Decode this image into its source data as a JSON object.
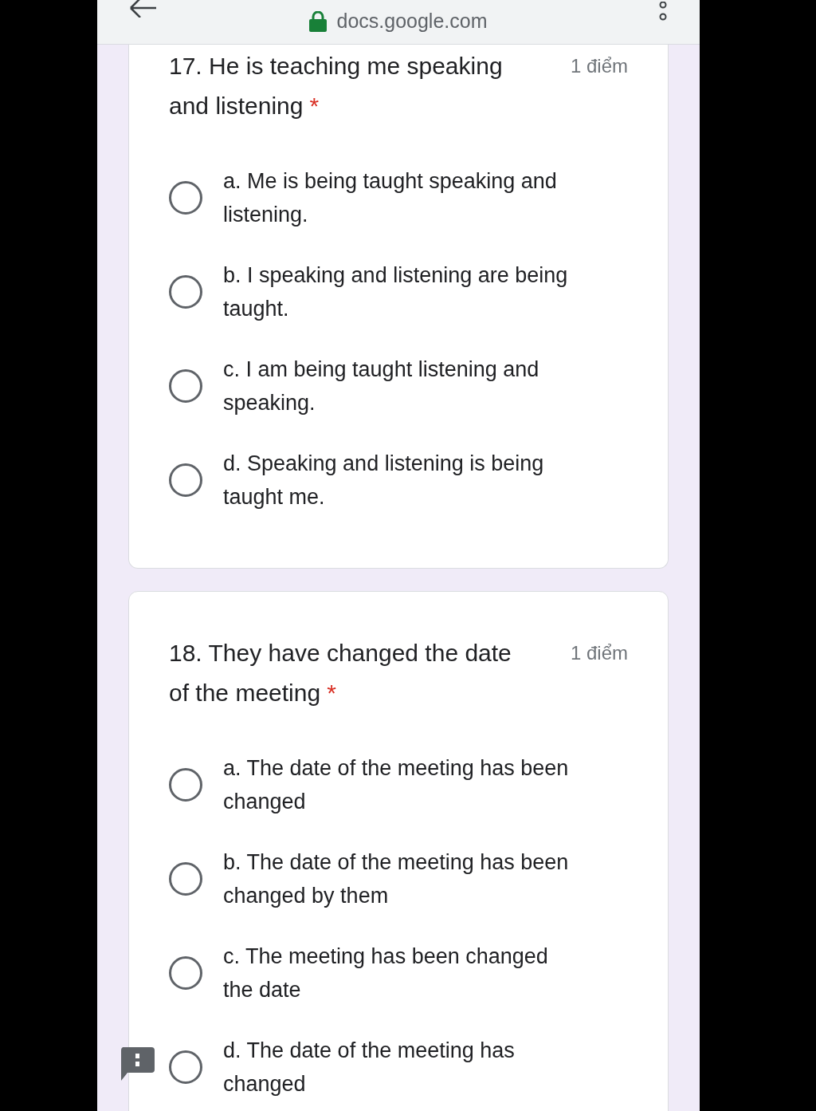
{
  "top_bar": {
    "url": "docs.google.com"
  },
  "questions": [
    {
      "title": "17. He is teaching me speaking and listening",
      "required_mark": "*",
      "points": "1 điểm",
      "options": [
        {
          "label": "a. Me is being taught speaking and listening.",
          "selected": false
        },
        {
          "label": "b. I speaking and listening are being taught.",
          "selected": false
        },
        {
          "label": "c. I am being taught listening and speaking.",
          "selected": false
        },
        {
          "label": "d. Speaking and listening is being taught me.",
          "selected": false
        }
      ]
    },
    {
      "title": "18. They have changed the date of the meeting",
      "required_mark": "*",
      "points": "1 điểm",
      "options": [
        {
          "label": "a. The date of the meeting has been changed",
          "selected": false
        },
        {
          "label": "b. The date of the meeting has been changed by them",
          "selected": false
        },
        {
          "label": "c. The meeting has been changed the date",
          "selected": false
        },
        {
          "label": "d. The date of the meeting has changed",
          "selected": false
        }
      ]
    }
  ]
}
